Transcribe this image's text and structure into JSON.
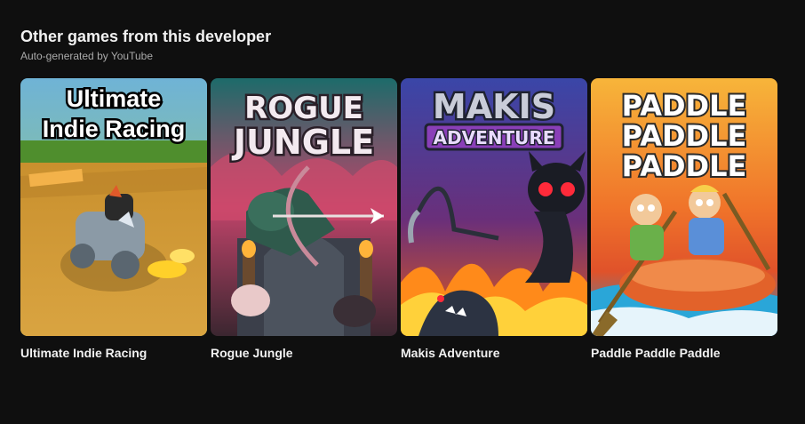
{
  "shelf": {
    "title": "Other games from this developer",
    "subtitle": "Auto-generated by YouTube"
  },
  "games": [
    {
      "title": "Ultimate Indie Racing",
      "art_line1": "Ultimate",
      "art_line2": "Indie Racing"
    },
    {
      "title": "Rogue Jungle",
      "art_line1": "ROGUE",
      "art_line2": "JUNGLE"
    },
    {
      "title": "Makis Adventure",
      "art_line1": "MAKIS",
      "art_line2": "ADVENTURE"
    },
    {
      "title": "Paddle Paddle Paddle",
      "art_line1": "PADDLE",
      "art_line2": "PADDLE",
      "art_line3": "PADDLE"
    }
  ]
}
